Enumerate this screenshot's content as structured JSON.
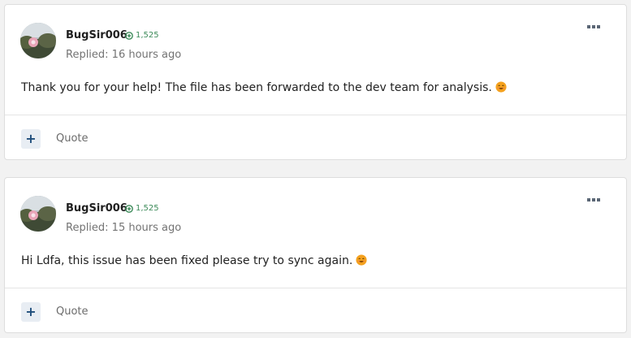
{
  "posts": [
    {
      "author": "BugSir006",
      "reputation": "1,525",
      "replied": "Replied: 16 hours ago",
      "body": "Thank you for your help! The file has been forwarded to the dev team for analysis.",
      "quote_label": "Quote",
      "plus_symbol": "+"
    },
    {
      "author": "BugSir006",
      "reputation": "1,525",
      "replied": "Replied: 15 hours ago",
      "body": "Hi Ldfa, this issue has been fixed please try to sync again.",
      "quote_label": "Quote",
      "plus_symbol": "+"
    }
  ],
  "icons": {
    "menu": "more-horizontal-icon",
    "reputation": "plus-circle-icon",
    "emoji": "smiling-face-icon"
  },
  "colors": {
    "reputation_green": "#3d8b5a",
    "plus_button_bg": "#e8edf3",
    "plus_button_fg": "#1e4d7b",
    "emoji": "#f4a11e"
  }
}
